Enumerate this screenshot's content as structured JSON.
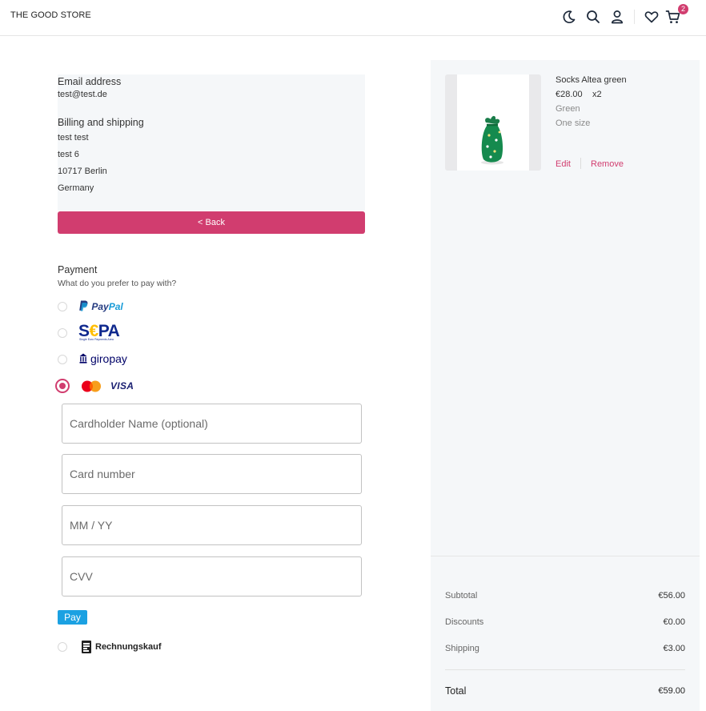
{
  "header": {
    "logo": "THE GOOD STORE",
    "cart_count": "2",
    "icons": [
      "moon-icon",
      "search-icon",
      "user-icon",
      "heart-icon",
      "cart-icon"
    ]
  },
  "summary": {
    "email_label": "Email address",
    "email_value": "test@test.de",
    "address_label": "Billing and shipping",
    "address_lines": [
      "test test",
      "test 6",
      "10717 Berlin",
      "Germany"
    ],
    "back_label": "< Back"
  },
  "payment": {
    "title": "Payment",
    "subtitle": "What do you prefer to pay with?",
    "paypal": {
      "pay": "Pay",
      "pal": "Pal"
    },
    "sepa": {
      "s": "S",
      "euro": "€",
      "pa": "PA",
      "sub": "Single Euro Payments Area"
    },
    "giropay": "giropay",
    "visa": "VISA",
    "card_fields": {
      "cardholder_placeholder": "Cardholder Name (optional)",
      "number_placeholder": "Card number",
      "expiry_placeholder": "MM / YY",
      "cvv_placeholder": "CVV"
    },
    "pay_label": "Pay",
    "invoice": "Rechnungskauf",
    "selected_method": "card"
  },
  "cart": {
    "item": {
      "name": "Socks Altea green",
      "price": "€28.00",
      "qty": "x2",
      "color": "Green",
      "size": "One size",
      "edit_label": "Edit",
      "remove_label": "Remove"
    },
    "totals": {
      "subtotal_label": "Subtotal",
      "subtotal_value": "€56.00",
      "discounts_label": "Discounts",
      "discounts_value": "€0.00",
      "shipping_label": "Shipping",
      "shipping_value": "€3.00",
      "total_label": "Total",
      "total_value": "€59.00"
    }
  },
  "colors": {
    "accent": "#d13d6f",
    "pay_button": "#1ba1e2",
    "sidebar_bg": "#f5f7f9"
  }
}
